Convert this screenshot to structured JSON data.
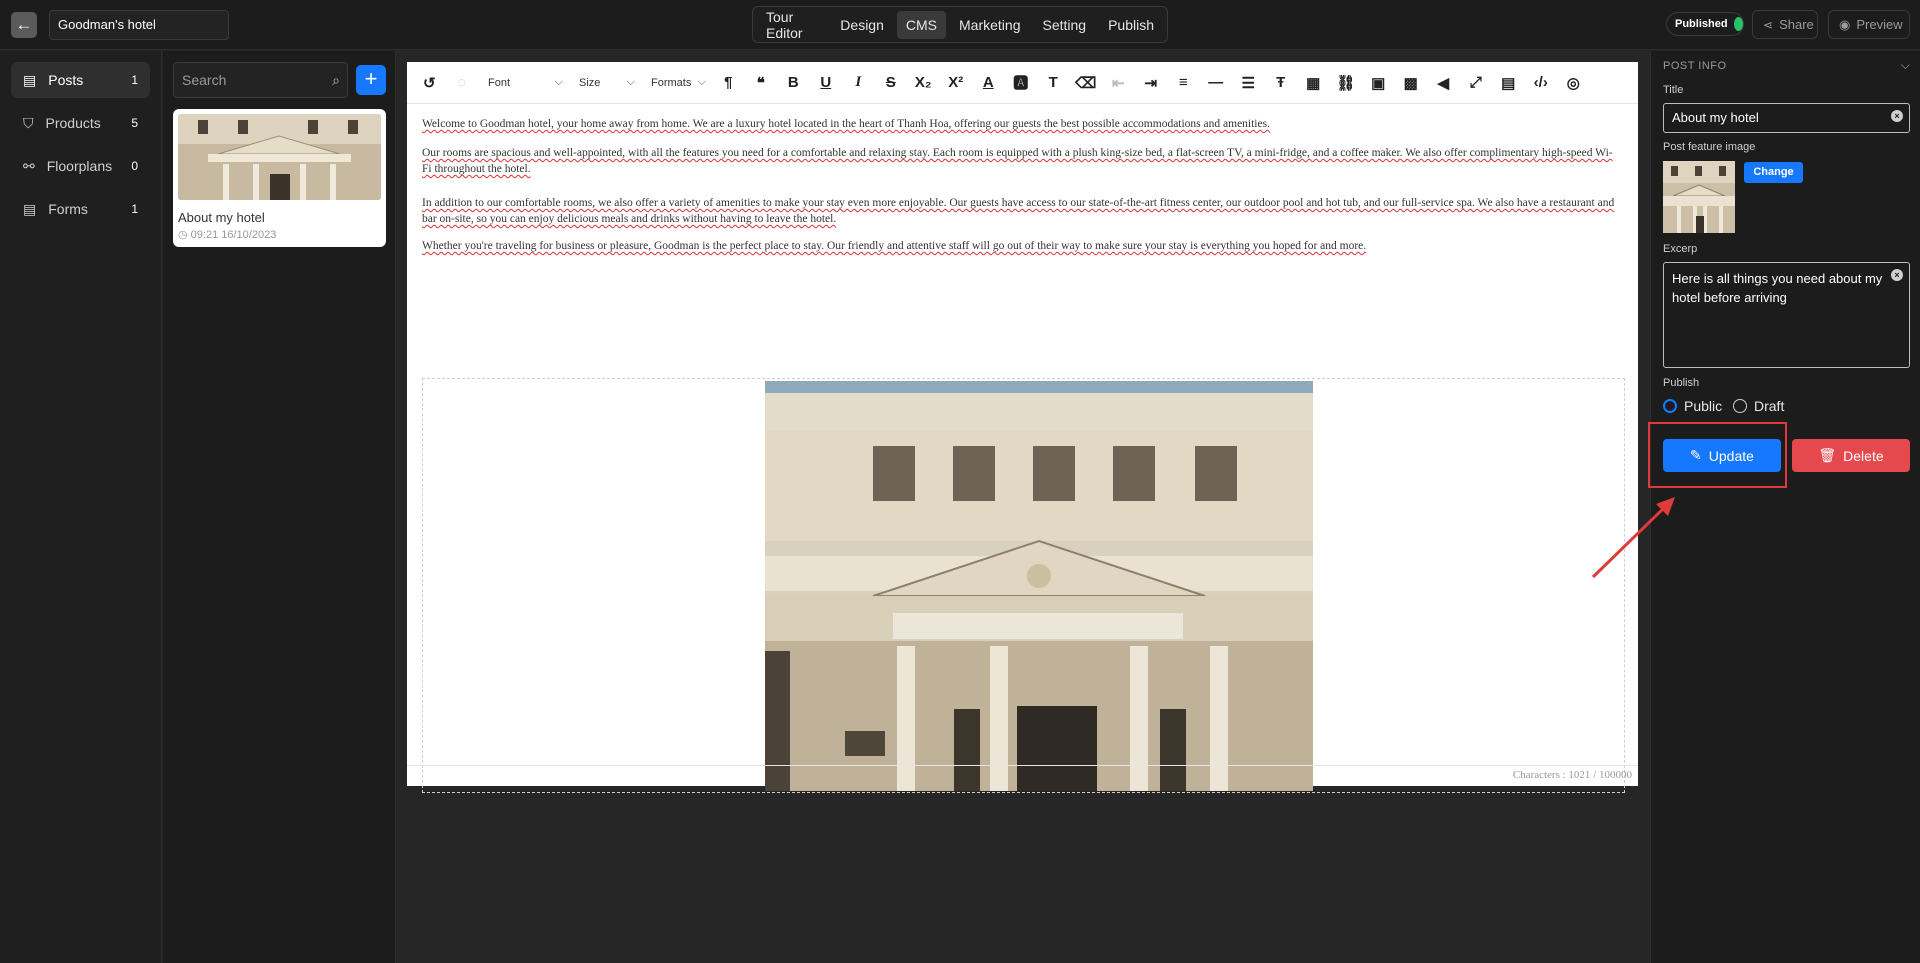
{
  "topbar": {
    "site_name": "Goodman's hotel",
    "nav": [
      "Tour Editor",
      "Design",
      "CMS",
      "Marketing",
      "Setting",
      "Publish"
    ],
    "active_nav": "CMS",
    "status": "Published",
    "share_label": "Share",
    "preview_label": "Preview"
  },
  "sidebar": {
    "items": [
      {
        "label": "Posts",
        "count": "1",
        "icon": "document-icon"
      },
      {
        "label": "Products",
        "count": "5",
        "icon": "tshirt-icon"
      },
      {
        "label": "Floorplans",
        "count": "0",
        "icon": "floorplan-icon"
      },
      {
        "label": "Forms",
        "count": "1",
        "icon": "document-icon"
      }
    ]
  },
  "posts": {
    "search_placeholder": "Search",
    "items": [
      {
        "title": "About my hotel",
        "date": "09:21 16/10/2023"
      }
    ]
  },
  "toolbar": {
    "font": "Font",
    "size": "Size",
    "formats": "Formats"
  },
  "editor": {
    "paragraphs": [
      "Welcome to Goodman hotel, your home away from home. We are a luxury hotel located in the heart of  Thanh Hoa, offering our guests the best possible accommodations and amenities.",
      "Our rooms are spacious and well-appointed, with all the features you need for a comfortable and relaxing stay. Each room is equipped with a plush king-size bed, a flat-screen TV, a mini-fridge, and a coffee maker. We also offer complimentary high-speed Wi-Fi throughout the hotel.",
      "In addition to our comfortable rooms, we also offer a variety of amenities to make your stay even more enjoyable. Our guests have access to our state-of-the-art fitness center, our outdoor pool and hot tub, and our full-service spa. We also have a restaurant and bar on-site, so you can enjoy delicious meals and drinks without having to leave the hotel.",
      "Whether you're traveling for business or pleasure, Goodman is the perfect place to stay. Our friendly and attentive staff will go out of their way to make sure your stay is everything you hoped for and more."
    ],
    "char_count": "Characters : 1021 / 100000"
  },
  "post_info": {
    "heading": "POST INFO",
    "title_label": "Title",
    "title_value": "About my hotel",
    "feature_image_label": "Post feature image",
    "change_label": "Change",
    "excerpt_label": "Excerp",
    "excerpt_value": "Here is all things you need about my hotel before arriving",
    "publish_label": "Publish",
    "public_label": "Public",
    "draft_label": "Draft",
    "update_label": "Update",
    "delete_label": "Delete"
  },
  "colors": {
    "accent": "#1677ff",
    "danger": "#e5484d",
    "status_green": "#27c26a"
  }
}
